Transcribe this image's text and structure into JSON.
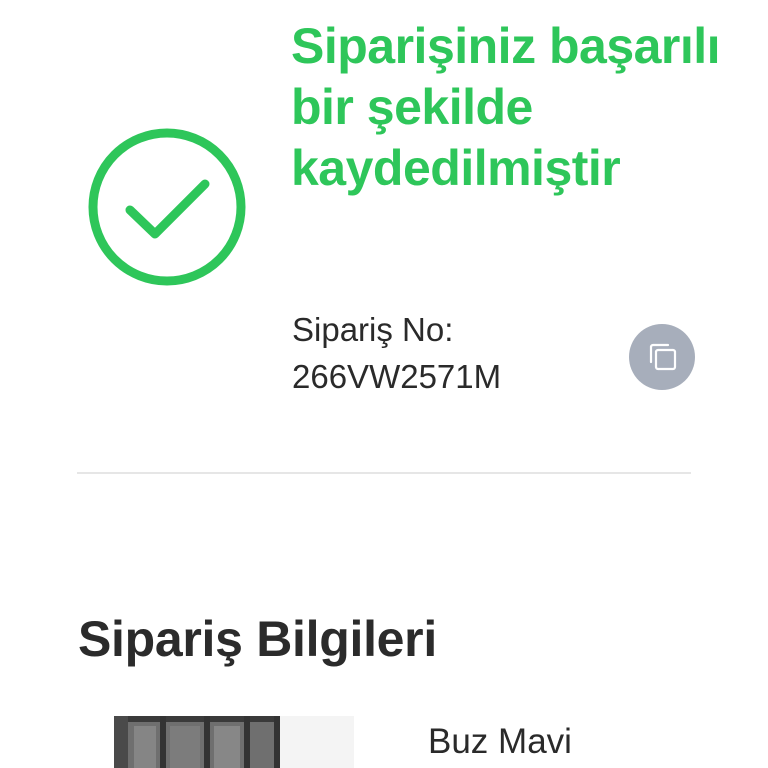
{
  "confirmation": {
    "title": "Siparişiniz başarılı bir şekilde kaydedilmiştir",
    "order_no_label": "Sipariş No:",
    "order_no_value": "266VW2571M",
    "success_icon": "check-circle-icon",
    "copy_icon": "copy-icon"
  },
  "order_info": {
    "title": "Sipariş Bilgileri",
    "product_name": "Buz Mavi"
  },
  "colors": {
    "success_green": "#2ec65a",
    "copy_button_bg": "#a7aebb",
    "divider": "#e6e6e6",
    "text": "#2a2a2a"
  }
}
